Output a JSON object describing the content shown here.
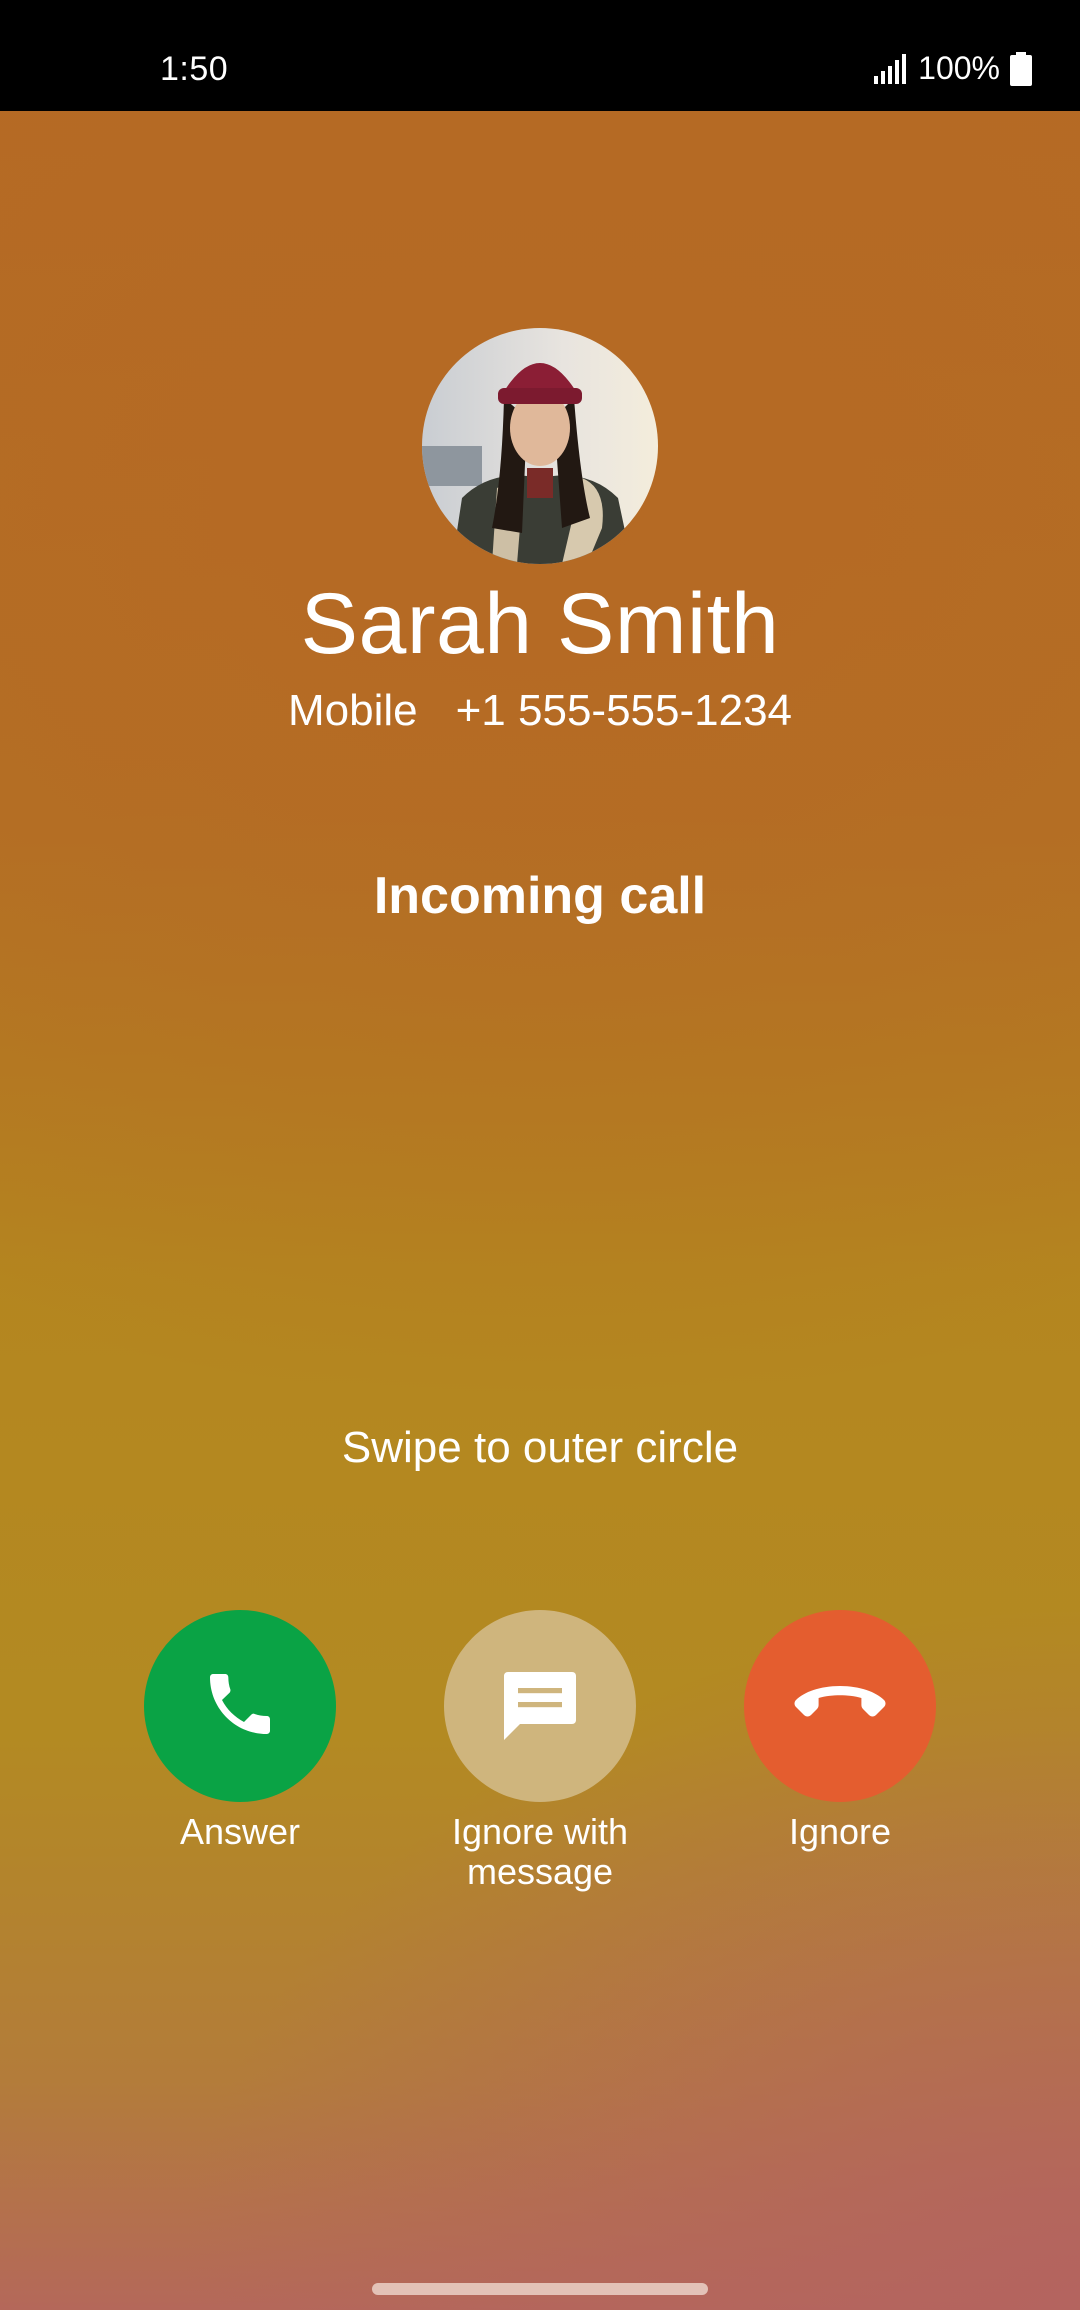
{
  "status_bar": {
    "time": "1:50",
    "battery_percent": "100%",
    "signal_icon": "cell-signal-icon",
    "battery_icon": "battery-full-icon"
  },
  "caller": {
    "name": "Sarah Smith",
    "number_type": "Mobile",
    "number": "+1 555-555-1234",
    "avatar_icon": "contact-photo"
  },
  "call": {
    "state": "Incoming call",
    "hint": "Swipe to outer circle"
  },
  "actions": [
    {
      "label": "Answer",
      "icon": "phone-icon",
      "color": "#0aa345"
    },
    {
      "label": "Ignore with\nmessage",
      "icon": "message-icon",
      "color": "#cfb57d"
    },
    {
      "label": "Ignore",
      "icon": "hang-up-icon",
      "color": "#e45d2f"
    }
  ],
  "colors": {
    "background_top": "#b56a25",
    "background_mid": "#b38a22",
    "background_bottom": "#b4685a"
  }
}
